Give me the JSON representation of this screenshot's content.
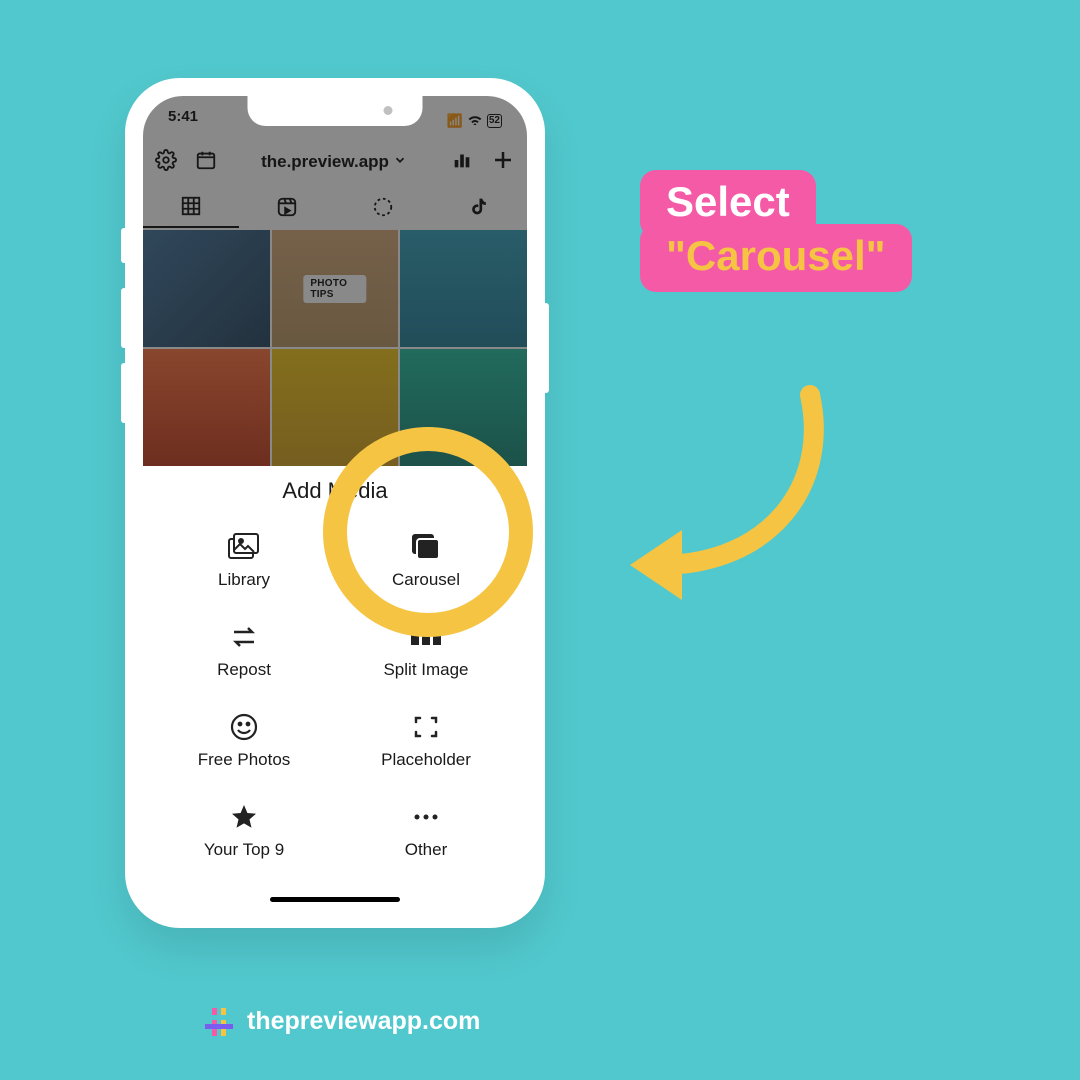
{
  "callout": {
    "line1": "Select",
    "line2": "\"Carousel\""
  },
  "status": {
    "time": "5:41",
    "battery": "52"
  },
  "toolbar": {
    "account": "the.preview.app"
  },
  "thumbs": {
    "badge": "PHOTO TIPS"
  },
  "sheet": {
    "title": "Add Media",
    "items": [
      {
        "label": "Library"
      },
      {
        "label": "Carousel"
      },
      {
        "label": "Repost"
      },
      {
        "label": "Split Image"
      },
      {
        "label": "Free Photos"
      },
      {
        "label": "Placeholder"
      },
      {
        "label": "Your Top 9"
      },
      {
        "label": "Other"
      }
    ]
  },
  "footer": {
    "site": "thepreviewapp.com"
  }
}
